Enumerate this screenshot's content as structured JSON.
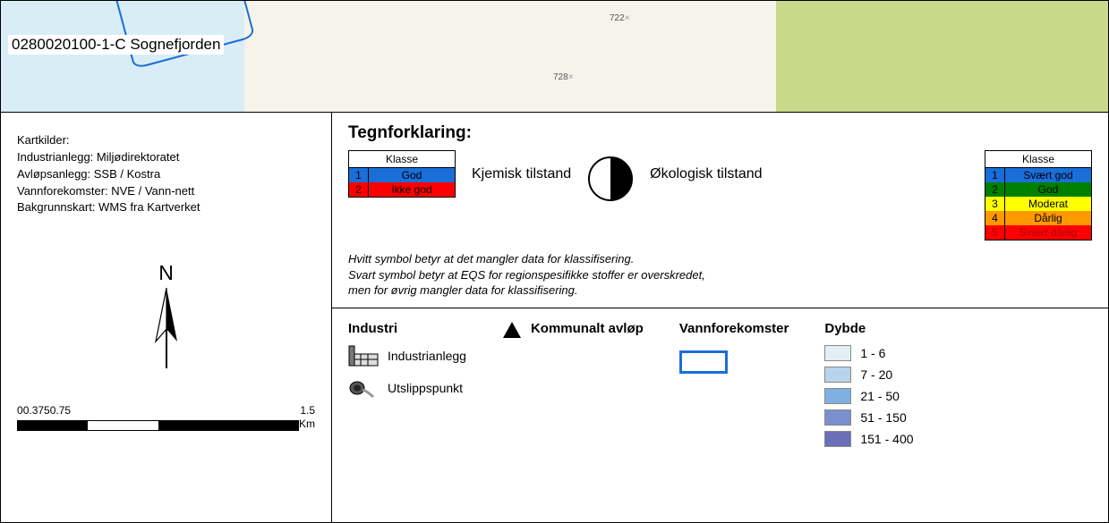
{
  "map": {
    "label": "0280020100-1-C Sognefjorden",
    "elevations": [
      "722",
      "728"
    ]
  },
  "sources": {
    "heading": "Kartkilder:",
    "lines": [
      "Industrianlegg: Miljødirektoratet",
      "Avløpsanlegg: SSB / Kostra",
      "Vannforekomster: NVE / Vann-nett",
      "Bakgrunnskart: WMS fra Kartverket"
    ]
  },
  "compass": {
    "n": "N"
  },
  "scalebar": {
    "ticks": [
      "0",
      "0.375",
      "0.75",
      "1.5"
    ],
    "unit": "Km"
  },
  "legend": {
    "title": "Tegnforklaring:",
    "kjemisk_table": {
      "header": "Klasse",
      "rows": [
        {
          "n": "1",
          "label": "God"
        },
        {
          "n": "2",
          "label": "Ikke god"
        }
      ]
    },
    "kjemisk_label": "Kjemisk tilstand",
    "okologisk_label": "Økologisk tilstand",
    "okologisk_table": {
      "header": "Klasse",
      "rows": [
        {
          "n": "1",
          "label": "Svært god"
        },
        {
          "n": "2",
          "label": "God"
        },
        {
          "n": "3",
          "label": "Moderat"
        },
        {
          "n": "4",
          "label": "Dårlig"
        },
        {
          "n": "5",
          "label": "Svært dårlig"
        }
      ]
    },
    "notes": [
      "Hvitt symbol betyr at det mangler data for klassifisering.",
      "Svart symbol betyr at EQS for regionspesifikke stoffer er overskredet,",
      "men for øvrig mangler data for klassifisering."
    ],
    "industri": {
      "title": "Industri",
      "items": [
        "Industrianlegg",
        "Utslippspunkt"
      ]
    },
    "kommunalt": {
      "title": "Kommunalt avløp"
    },
    "vannforekomster": {
      "title": "Vannforekomster"
    },
    "dybde": {
      "title": "Dybde",
      "ranges": [
        {
          "label": "1 - 6",
          "color": "#e2f0f5"
        },
        {
          "label": "7 - 20",
          "color": "#b8d4ec"
        },
        {
          "label": "21 - 50",
          "color": "#7fb1e0"
        },
        {
          "label": "51 - 150",
          "color": "#7a8fce"
        },
        {
          "label": "151 - 400",
          "color": "#6a6fb8"
        }
      ]
    }
  }
}
